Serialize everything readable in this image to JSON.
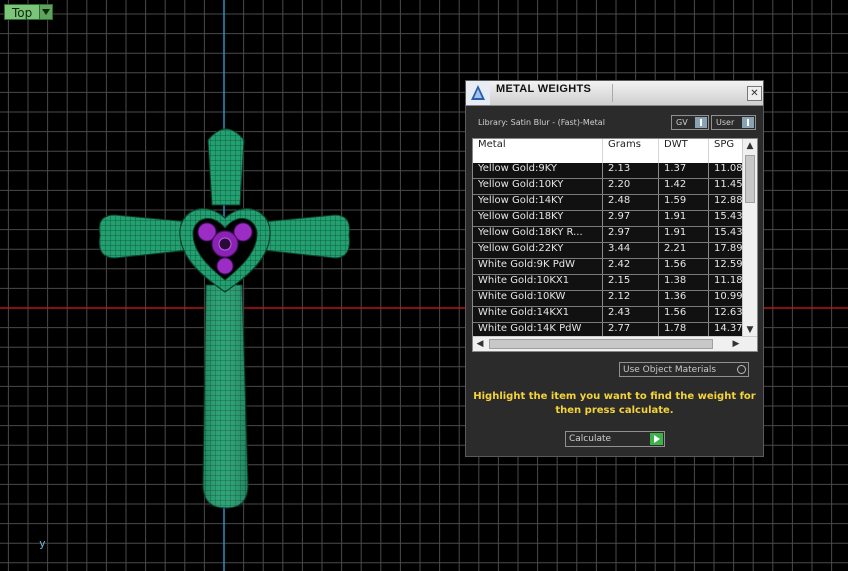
{
  "viewport": {
    "view_label": "Top",
    "axis_label": "y"
  },
  "panel": {
    "title": "METAL WEIGHTS",
    "library": "Library: Satin Blur - (Fast)-Metal",
    "gv_label": "GV",
    "user_label": "User",
    "columns": [
      "Metal",
      "Grams",
      "DWT",
      "SPG"
    ],
    "rows": [
      {
        "metal": "Yellow Gold:9KY",
        "grams": "2.13",
        "dwt": "1.37",
        "spg": "11.08"
      },
      {
        "metal": "Yellow Gold:10KY",
        "grams": "2.20",
        "dwt": "1.42",
        "spg": "11.45"
      },
      {
        "metal": "Yellow Gold:14KY",
        "grams": "2.48",
        "dwt": "1.59",
        "spg": "12.88"
      },
      {
        "metal": "Yellow Gold:18KY",
        "grams": "2.97",
        "dwt": "1.91",
        "spg": "15.43"
      },
      {
        "metal": "Yellow Gold:18KY R...",
        "grams": "2.97",
        "dwt": "1.91",
        "spg": "15.43"
      },
      {
        "metal": "Yellow Gold:22KY",
        "grams": "3.44",
        "dwt": "2.21",
        "spg": "17.89"
      },
      {
        "metal": "White Gold:9K PdW",
        "grams": "2.42",
        "dwt": "1.56",
        "spg": "12.59"
      },
      {
        "metal": "White Gold:10KX1",
        "grams": "2.15",
        "dwt": "1.38",
        "spg": "11.18"
      },
      {
        "metal": "White Gold:10KW",
        "grams": "2.12",
        "dwt": "1.36",
        "spg": "10.99"
      },
      {
        "metal": "White Gold:14KX1",
        "grams": "2.43",
        "dwt": "1.56",
        "spg": "12.63"
      },
      {
        "metal": "White Gold:14K PdW",
        "grams": "2.77",
        "dwt": "1.78",
        "spg": "14.37"
      }
    ],
    "use_object_materials": "Use Object Materials",
    "hint": "Highlight the item you want to find the weight for then press calculate.",
    "calculate_label": "Calculate",
    "close_glyph": "✕"
  },
  "colors": {
    "grid": "#4a4a4a",
    "x_axis": "#b01818",
    "y_axis": "#2b8fbf",
    "model": "#1f9a6c",
    "model_wire": "#0b3d2a",
    "gem": "#9b2cc4",
    "hint": "#f4d43a"
  }
}
